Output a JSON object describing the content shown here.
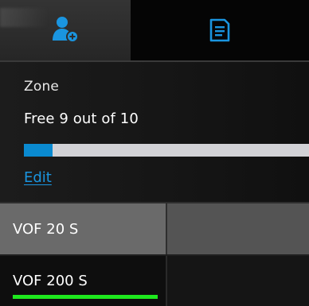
{
  "tabs": [
    {
      "icon": "add-user-icon",
      "active": true
    },
    {
      "icon": "document-icon",
      "active": false
    }
  ],
  "colors": {
    "accent": "#1a95e0",
    "progress_fill": "#0a8ad0",
    "progress_track": "#d2d2d6",
    "selection": "#1ee81e"
  },
  "zone": {
    "heading": "Zone",
    "status": "Free 9 out of 10",
    "used_fraction": 0.1,
    "edit_label": "Edit"
  },
  "list": {
    "items": [
      {
        "label": "VOF 20 S",
        "selected": false
      },
      {
        "label": "VOF 200 S",
        "selected": true
      }
    ]
  }
}
